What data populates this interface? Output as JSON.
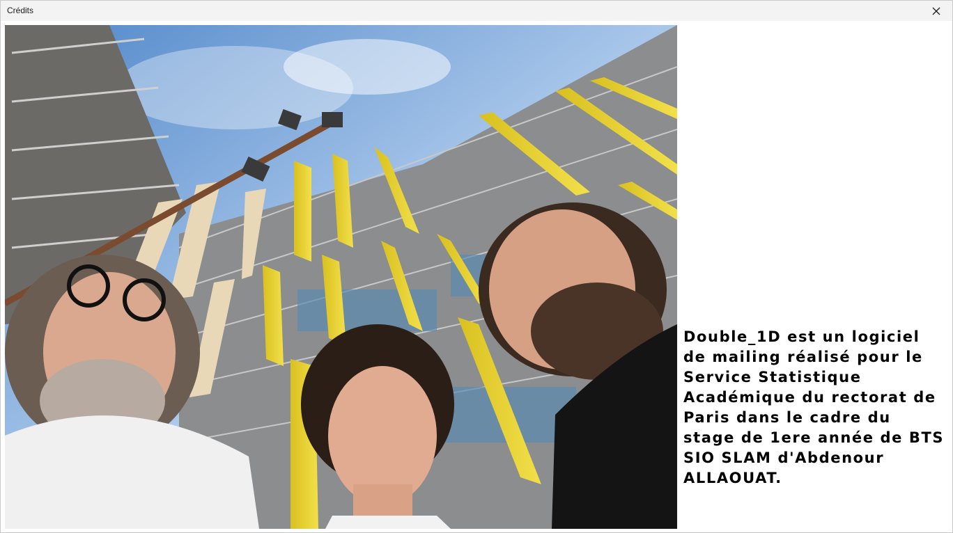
{
  "window": {
    "title": "Crédits",
    "close_icon": "close-icon"
  },
  "photo": {
    "description_icon": "team-photo"
  },
  "credits": {
    "text": "Double_1D est un logiciel\nde mailing réalisé pour le\nService Statistique\nAcadémique du rectorat de\nParis dans le cadre du\nstage de 1ere année de BTS\nSIO SLAM d'Abdenour\nALLAOUAT."
  }
}
